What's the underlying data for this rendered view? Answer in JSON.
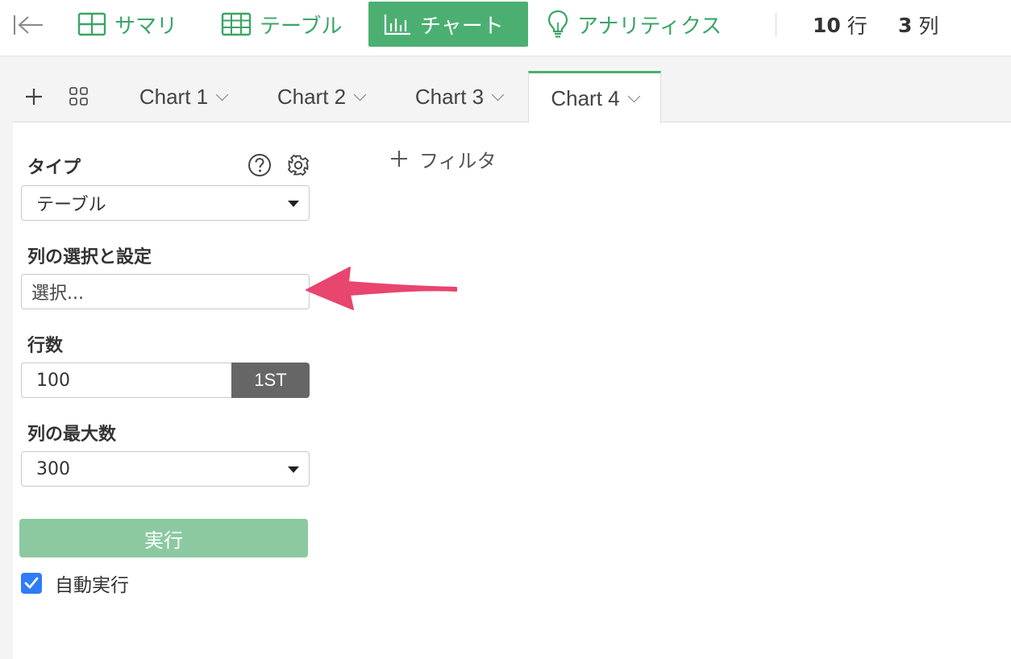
{
  "toolbar": {
    "nav": [
      {
        "label": "サマリ",
        "icon": "summary-grid-icon"
      },
      {
        "label": "テーブル",
        "icon": "table-icon"
      },
      {
        "label": "チャート",
        "icon": "chart-icon",
        "active": true
      },
      {
        "label": "アナリティクス",
        "icon": "lightbulb-icon"
      }
    ],
    "rows_count": "10",
    "rows_unit": "行",
    "cols_count": "3",
    "cols_unit": "列"
  },
  "tabs": [
    {
      "label": "Chart 1"
    },
    {
      "label": "Chart 2"
    },
    {
      "label": "Chart 3"
    },
    {
      "label": "Chart 4",
      "active": true
    }
  ],
  "panel": {
    "type_label": "タイプ",
    "type_value": "テーブル",
    "columns_label": "列の選択と設定",
    "columns_placeholder": "選択...",
    "rows_label": "行数",
    "rows_value": "100",
    "rows_addon": "1ST",
    "max_cols_label": "列の最大数",
    "max_cols_value": "300",
    "run_label": "実行",
    "auto_run_label": "自動実行",
    "auto_run_checked": true
  },
  "filter": {
    "add_label": "フィルタ"
  },
  "colors": {
    "accent": "#4caf72",
    "accent_text": "#3aa566",
    "run_button": "#8cc9a1",
    "annotation_arrow": "#e8456f",
    "checkbox": "#2f7cf6"
  }
}
